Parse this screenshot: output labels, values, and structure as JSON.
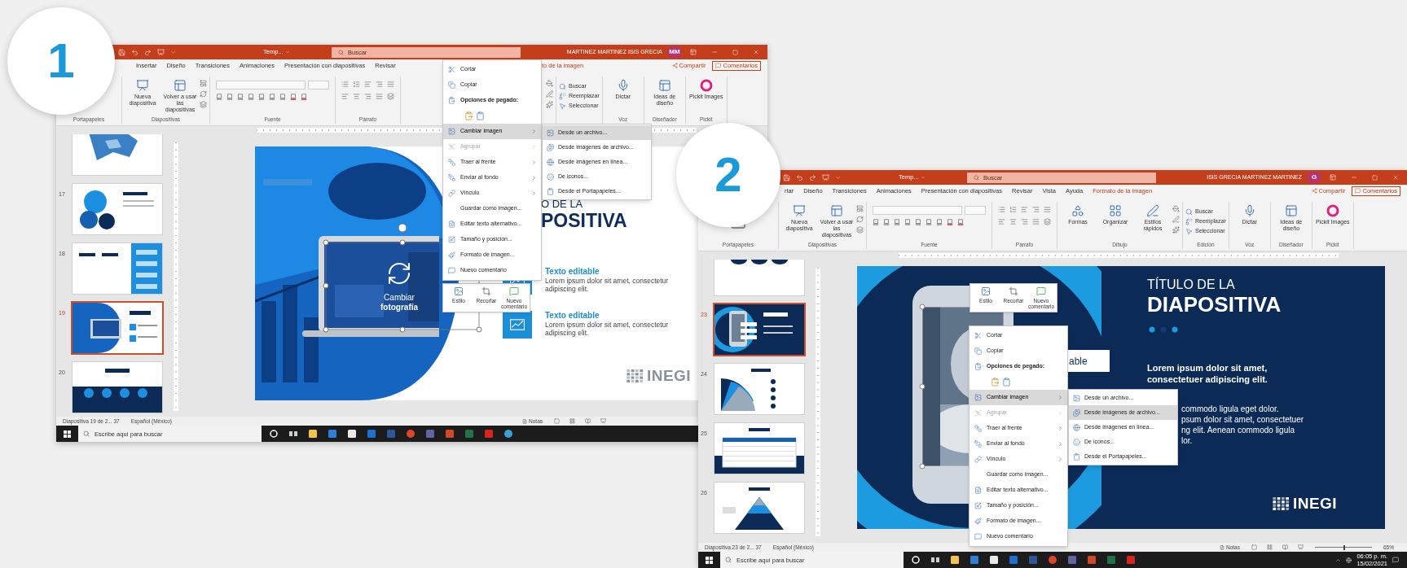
{
  "badges": [
    "1",
    "2"
  ],
  "windows": [
    {
      "document": "Temp...",
      "search": {
        "placeholder": "Buscar"
      },
      "user": "MARTINEZ MARTINEZ ISIS GRECIA",
      "initials": "MM",
      "tabs": [
        {
          "label": "Insertar",
          "contextual": false
        },
        {
          "label": "Diseño",
          "contextual": false
        },
        {
          "label": "Transiciones",
          "contextual": false
        },
        {
          "label": "Animaciones",
          "contextual": false
        },
        {
          "label": "Presentación con diapositivas",
          "contextual": false
        },
        {
          "label": "Revisar",
          "contextual": false
        },
        {
          "label": "to de la imagen",
          "contextual": true
        }
      ],
      "share": "Compartir",
      "comments": "Comentarios",
      "ribbon": [
        {
          "label": "Portapapeles",
          "tools": [
            {
              "kind": "paste"
            }
          ]
        },
        {
          "label": "Diapositivas",
          "tools": [
            {
              "kind": "new-slide",
              "label": "Nueva diapositiva"
            },
            {
              "kind": "reuse",
              "label": "Volver a usar las diapositivas"
            },
            {
              "kind": "layout-stack"
            }
          ]
        },
        {
          "label": "Fuente",
          "tools": [
            {
              "kind": "font"
            }
          ]
        },
        {
          "label": "Párrafo",
          "tools": [
            {
              "kind": "paragraph"
            }
          ]
        },
        {
          "tools": [
            {
              "kind": "shape-format"
            }
          ]
        },
        {
          "tools": [
            {
              "kind": "find",
              "label": "Buscar"
            },
            {
              "kind": "replace",
              "label": "Reemplazar"
            },
            {
              "kind": "select",
              "label": "Seleccionar"
            }
          ]
        },
        {
          "label": "Voz",
          "tools": [
            {
              "kind": "dictate",
              "label": "Dictar"
            }
          ]
        },
        {
          "label": "Diseñador",
          "tools": [
            {
              "kind": "designer",
              "label": "Ideas de diseño"
            }
          ]
        },
        {
          "label": "Pickit",
          "tools": [
            {
              "kind": "pickit",
              "label": "Pickit Images"
            }
          ]
        }
      ],
      "slides": [
        {
          "kind": "map",
          "selected": false
        },
        {
          "number": "17",
          "kind": "circles",
          "selected": false
        },
        {
          "number": "18",
          "kind": "steps",
          "selected": false
        },
        {
          "number": "19",
          "kind": "laptop",
          "selected": true
        },
        {
          "number": "20",
          "kind": "timeline",
          "selected": false
        }
      ],
      "slide": {
        "kind": "laptop",
        "caption": [
          "Cambiar",
          "fotografía"
        ],
        "title": [
          "O DE LA",
          "POSITIVA"
        ],
        "items": [
          {
            "heading": "Texto editable",
            "body": "Lorem ipsum dolor sit amet, consectetur adipiscing elit."
          },
          {
            "heading": "Texto editable",
            "body": "Lorem ipsum dolor sit amet, consectetur adipiscing elit."
          }
        ],
        "logo": "INEGI"
      },
      "mini_toolbar": [
        "Estilo",
        "Recortar",
        "Nuevo comentario"
      ],
      "menu": [
        {
          "kind": "command",
          "label": "Cortar",
          "selected": false,
          "disabled": false,
          "submenu": false
        },
        {
          "kind": "command",
          "label": "Copiar",
          "selected": false,
          "disabled": false,
          "submenu": false
        },
        {
          "kind": "heading",
          "label": "Opciones de pegado:",
          "selected": false,
          "disabled": false,
          "submenu": false
        },
        {
          "kind": "paste-options",
          "selected": false,
          "disabled": false,
          "submenu": false
        },
        {
          "kind": "command",
          "label": "Cambiar imagen",
          "selected": true,
          "disabled": false,
          "submenu": true
        },
        {
          "kind": "command",
          "label": "Agrupar",
          "selected": false,
          "disabled": true,
          "submenu": true
        },
        {
          "kind": "command",
          "label": "Traer al frente",
          "selected": false,
          "disabled": false,
          "submenu": true
        },
        {
          "kind": "command",
          "label": "Enviar al fondo",
          "selected": false,
          "disabled": false,
          "submenu": true
        },
        {
          "kind": "command",
          "label": "Vínculo",
          "selected": false,
          "disabled": false,
          "submenu": true
        },
        {
          "kind": "command",
          "label": "Guardar como imagen...",
          "selected": false,
          "disabled": false,
          "submenu": false
        },
        {
          "kind": "command",
          "label": "Editar texto alternativo...",
          "selected": false,
          "disabled": false,
          "submenu": false
        },
        {
          "kind": "command",
          "label": "Tamaño y posición...",
          "selected": false,
          "disabled": false,
          "submenu": false
        },
        {
          "kind": "command",
          "label": "Formato de imagen...",
          "selected": false,
          "disabled": false,
          "submenu": false
        },
        {
          "kind": "command",
          "label": "Nuevo comentario",
          "selected": false,
          "disabled": false,
          "submenu": false
        }
      ],
      "submenu": [
        {
          "label": "Desde un archivo...",
          "selected": true
        },
        {
          "label": "Desde imágenes de archivo...",
          "selected": false
        },
        {
          "label": "Desde imágenes en línea...",
          "selected": false
        },
        {
          "label": "De iconos...",
          "selected": false
        },
        {
          "label": "Desde el Portapapeles...",
          "selected": false
        }
      ],
      "status": {
        "slide": "Diapositiva 19 de 2... 37",
        "language": "Español (México)",
        "notes": "Notas"
      },
      "taskbar": {
        "search": {
          "placeholder": "Escribe aquí para buscar"
        }
      }
    },
    {
      "document": "Temp...",
      "search": {
        "placeholder": "Buscar"
      },
      "user": "ISIS GRECIA MARTINEZ MARTINEZ",
      "initials": "G",
      "tabs": [
        {
          "label": "rtar",
          "contextual": false
        },
        {
          "label": "Diseño",
          "contextual": false
        },
        {
          "label": "Transiciones",
          "contextual": false
        },
        {
          "label": "Animaciones",
          "contextual": false
        },
        {
          "label": "Presentación con diapositivas",
          "contextual": false
        },
        {
          "label": "Revisar",
          "contextual": false
        },
        {
          "label": "Vista",
          "contextual": false
        },
        {
          "label": "Ayuda",
          "contextual": false
        },
        {
          "label": "Formato de la imagen",
          "contextual": true
        }
      ],
      "share": "Compartir",
      "comments": "Comentarios",
      "ribbon": [
        {
          "label": "Portapapeles",
          "tools": [
            {
              "kind": "paste"
            }
          ]
        },
        {
          "label": "Diapositivas",
          "tools": [
            {
              "kind": "new-slide",
              "label": "Nueva diapositiva"
            },
            {
              "kind": "reuse",
              "label": "Volver a usar las diapositivas"
            },
            {
              "kind": "layout-stack"
            }
          ]
        },
        {
          "label": "Fuente",
          "tools": [
            {
              "kind": "font"
            }
          ]
        },
        {
          "label": "Párrafo",
          "tools": [
            {
              "kind": "paragraph"
            }
          ]
        },
        {
          "label": "Dibujo",
          "tools": [
            {
              "kind": "shapes",
              "label": "Formas"
            },
            {
              "kind": "arrange",
              "label": "Organizar"
            },
            {
              "kind": "quick-styles",
              "label": "Estilos rápidos"
            },
            {
              "kind": "shape-format"
            }
          ]
        },
        {
          "label": "Edición",
          "tools": [
            {
              "kind": "find",
              "label": "Buscar"
            },
            {
              "kind": "replace",
              "label": "Reemplazar"
            },
            {
              "kind": "select",
              "label": "Seleccionar"
            }
          ]
        },
        {
          "label": "Voz",
          "tools": [
            {
              "kind": "dictate",
              "label": "Dictar"
            }
          ]
        },
        {
          "label": "Diseñador",
          "tools": [
            {
              "kind": "designer",
              "label": "Ideas de diseño"
            }
          ]
        },
        {
          "label": "Pickit",
          "tools": [
            {
              "kind": "pickit",
              "label": "Pickit Images"
            }
          ]
        }
      ],
      "slides": [
        {
          "kind": "nodes",
          "selected": false
        },
        {
          "number": "23",
          "kind": "phone",
          "selected": true
        },
        {
          "number": "24",
          "kind": "fan",
          "selected": false
        },
        {
          "number": "25",
          "kind": "table",
          "selected": false
        },
        {
          "number": "26",
          "kind": "pyramid",
          "selected": false
        }
      ],
      "slide": {
        "kind": "phone",
        "callout": "able",
        "title": [
          "TÍTULO DE LA",
          "DIAPOSITIVA"
        ],
        "lead": "Lorem ipsum dolor sit amet, consectetuer adipiscing elit.",
        "body": [
          "commodo ligula eget dolor.",
          "psum dolor sit amet, consectetuer",
          "ng elit. Aenean commodo ligula",
          "lor."
        ],
        "logo": "INEGI"
      },
      "mini_toolbar": [
        "Estilo",
        "Recortar",
        "Nuevo comentario"
      ],
      "menu": [
        {
          "kind": "command",
          "label": "Cortar",
          "selected": false,
          "disabled": false,
          "submenu": false
        },
        {
          "kind": "command",
          "label": "Copiar",
          "selected": false,
          "disabled": false,
          "submenu": false
        },
        {
          "kind": "heading",
          "label": "Opciones de pegado:",
          "selected": false,
          "disabled": false,
          "submenu": false
        },
        {
          "kind": "paste-options",
          "selected": false,
          "disabled": false,
          "submenu": false
        },
        {
          "kind": "command",
          "label": "Cambiar imagen",
          "selected": true,
          "disabled": false,
          "submenu": true
        },
        {
          "kind": "command",
          "label": "Agrupar",
          "selected": false,
          "disabled": true,
          "submenu": true
        },
        {
          "kind": "command",
          "label": "Traer al frente",
          "selected": false,
          "disabled": false,
          "submenu": true
        },
        {
          "kind": "command",
          "label": "Enviar al fondo",
          "selected": false,
          "disabled": false,
          "submenu": true
        },
        {
          "kind": "command",
          "label": "Vínculo",
          "selected": false,
          "disabled": false,
          "submenu": true
        },
        {
          "kind": "command",
          "label": "Guardar como imagen...",
          "selected": false,
          "disabled": false,
          "submenu": false
        },
        {
          "kind": "command",
          "label": "Editar texto alternativo...",
          "selected": false,
          "disabled": false,
          "submenu": false
        },
        {
          "kind": "command",
          "label": "Tamaño y posición...",
          "selected": false,
          "disabled": false,
          "submenu": false
        },
        {
          "kind": "command",
          "label": "Formato de imagen...",
          "selected": false,
          "disabled": false,
          "submenu": false
        },
        {
          "kind": "command",
          "label": "Nuevo comentario",
          "selected": false,
          "disabled": false,
          "submenu": false
        }
      ],
      "submenu": [
        {
          "label": "Desde un archivo...",
          "selected": false
        },
        {
          "label": "Desde imágenes de archivo...",
          "selected": true
        },
        {
          "label": "Desde imágenes en línea...",
          "selected": false
        },
        {
          "label": "De iconos...",
          "selected": false
        },
        {
          "label": "Desde el Portapapeles...",
          "selected": false
        }
      ],
      "status": {
        "slide": "Diapositiva 23 de 2... 37",
        "language": "Español (México)",
        "notes": "Notas",
        "zoom": "65%",
        "zoom_slider": {
          "level": 0.5
        }
      },
      "taskbar": {
        "search": {
          "placeholder": "Escribe aquí para buscar"
        },
        "time": "06:05 p. m.",
        "date": "15/02/2021"
      }
    }
  ]
}
